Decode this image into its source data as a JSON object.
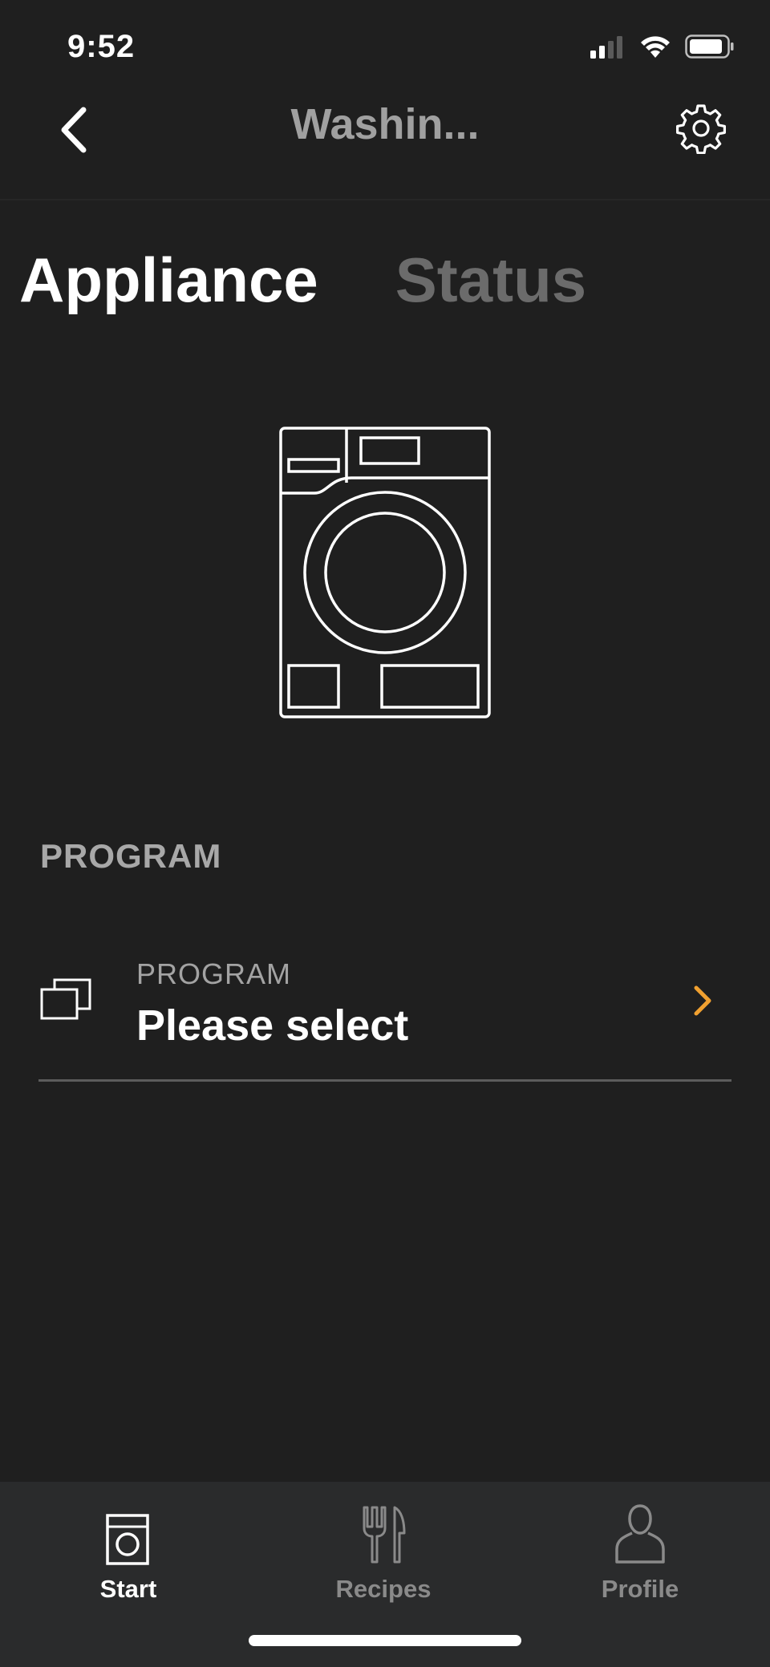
{
  "status_bar": {
    "time": "9:52"
  },
  "header": {
    "title": "Washin...",
    "back_icon": "chevron-left-icon",
    "settings_icon": "gear-icon"
  },
  "tabs": [
    {
      "label": "Appliance",
      "active": true
    },
    {
      "label": "Status",
      "active": false
    }
  ],
  "program_section": {
    "heading": "PROGRAM",
    "row": {
      "label": "PROGRAM",
      "value": "Please select",
      "icon": "stacked-windows-icon",
      "chevron_icon": "chevron-right-icon",
      "chevron_color": "#f0a030"
    }
  },
  "tab_bar": {
    "items": [
      {
        "label": "Start",
        "icon": "washing-machine-icon",
        "active": true
      },
      {
        "label": "Recipes",
        "icon": "fork-knife-icon",
        "active": false
      },
      {
        "label": "Profile",
        "icon": "person-icon",
        "active": false
      }
    ]
  },
  "colors": {
    "background": "#1f1f1f",
    "tab_bar_background": "#2a2b2c",
    "accent": "#f0a030"
  }
}
